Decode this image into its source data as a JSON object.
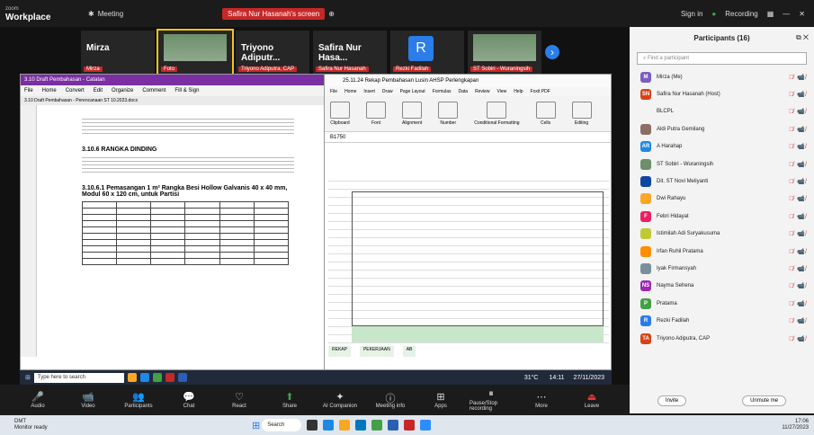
{
  "app": {
    "brand_small": "zoom",
    "brand": "Workplace",
    "host_label": "Meeting",
    "recording_label": "Safira Nur Hasanah's screen",
    "right_status": "Sign in",
    "recording": "Recording"
  },
  "tiles": [
    {
      "name": "Mirza",
      "label": "Mirza",
      "kind": "text"
    },
    {
      "name": "photo",
      "label": "Foto",
      "kind": "photo"
    },
    {
      "name": "Triyono Adiputr...",
      "label": "Triyono Adiputra, CAP",
      "kind": "text"
    },
    {
      "name": "Safira Nur Hasa...",
      "label": "Safira Nur Hasanah",
      "kind": "text"
    },
    {
      "name": "R",
      "label": "Rezki Fadilah",
      "kind": "avatar"
    },
    {
      "name": "photo2",
      "label": "ST Sobiri - Wuraningsih",
      "kind": "photo"
    }
  ],
  "word": {
    "title": "3.10 Draft Pembahasan - Catatan",
    "menus": [
      "File",
      "Home",
      "Convert",
      "Edit",
      "Organize",
      "Comment",
      "Fill & Sign"
    ],
    "tab_label": "3.10 Draft Pembahasan - Perencanaan ST 10.2023.docx",
    "heading1": "3.10.6 RANGKA DINDING",
    "heading2": "3.10.6.1 Pemasangan 1 m² Rangka Besi Hollow Galvanis 40 x 40 mm, Modul 60 x 120 cm, untuk Partisi"
  },
  "excel": {
    "title": "25.11.24 Rekap Pembahasan Lusin AHSP Perlengkapan",
    "menus": [
      "File",
      "Home",
      "Insert",
      "Draw",
      "Page Layout",
      "Formulas",
      "Data",
      "Review",
      "View",
      "Help",
      "Foxit PDF"
    ],
    "ribbon": [
      "Clipboard",
      "Font",
      "Alignment",
      "Number",
      "Conditional Formatting",
      "Cells",
      "Editing"
    ],
    "namebox": "B1750",
    "tabs": [
      "REKAP",
      "PEKERJAAN",
      "AB"
    ]
  },
  "taskbar_inner": {
    "search": "Type here to search",
    "weather": "31°C",
    "time": "14:11",
    "date": "27/11/2023"
  },
  "controls": [
    {
      "label": "Audio",
      "glyph": "🎤",
      "tone": "red"
    },
    {
      "label": "Video",
      "glyph": "📹",
      "tone": "red"
    },
    {
      "label": "Participants",
      "glyph": "👥",
      "tone": "normal"
    },
    {
      "label": "Chat",
      "glyph": "💬",
      "tone": "normal"
    },
    {
      "label": "React",
      "glyph": "♡",
      "tone": "normal"
    },
    {
      "label": "Share",
      "glyph": "⬆",
      "tone": "green"
    },
    {
      "label": "AI Companion",
      "glyph": "✦",
      "tone": "normal"
    },
    {
      "label": "Meeting info",
      "glyph": "ⓘ",
      "tone": "normal"
    },
    {
      "label": "Apps",
      "glyph": "⊞",
      "tone": "normal"
    },
    {
      "label": "Pause/Stop recording",
      "glyph": "⏸",
      "tone": "normal"
    },
    {
      "label": "More",
      "glyph": "⋯",
      "tone": "normal"
    },
    {
      "label": "Leave",
      "glyph": "⏏",
      "tone": "leave"
    }
  ],
  "panel": {
    "title": "Participants (16)",
    "search_placeholder": "Find a participant",
    "invite": "Invite",
    "unmute_me": "Unmute me",
    "participants": [
      {
        "initials": "M",
        "name": "Mirza (Me)",
        "color": "#7b5cc2"
      },
      {
        "initials": "SN",
        "name": "Safira Nur Hasanah (Host)",
        "color": "#d84315"
      },
      {
        "initials": "",
        "name": "BLCPL",
        "color": "#f3f3f3"
      },
      {
        "initials": "",
        "name": "Aldi Putra Gemilang",
        "color": "#8d6e63"
      },
      {
        "initials": "AR",
        "name": "A Harahap",
        "color": "#1e88e5"
      },
      {
        "initials": "",
        "name": "ST Sobiri - Wuraningsih",
        "color": "#6d8f6a"
      },
      {
        "initials": "",
        "name": "Dit. ST Novi Meliyanti",
        "color": "#0d47a1"
      },
      {
        "initials": "",
        "name": "Dwi Rahayu",
        "color": "#f9a825"
      },
      {
        "initials": "F",
        "name": "Febri Hidayat",
        "color": "#e91e63"
      },
      {
        "initials": "",
        "name": "Istimilah Adi Suryakusuma",
        "color": "#c0ca33"
      },
      {
        "initials": "",
        "name": "Irfan Ruhil Pratama",
        "color": "#ff8f00"
      },
      {
        "initials": "",
        "name": "Iyak Firmansyah",
        "color": "#78909c"
      },
      {
        "initials": "NS",
        "name": "Nayma Sehena",
        "color": "#9c27b0"
      },
      {
        "initials": "P",
        "name": "Pratama",
        "color": "#43a047"
      },
      {
        "initials": "R",
        "name": "Rezki Fadilah",
        "color": "#2b7de9"
      },
      {
        "initials": "TA",
        "name": "Triyono Adiputra, CAP",
        "color": "#d84315"
      }
    ]
  },
  "windows": {
    "user": "DMT",
    "user_sub": "Monitor ready",
    "search": "Search",
    "time": "17:06",
    "date": "11/27/2023"
  }
}
